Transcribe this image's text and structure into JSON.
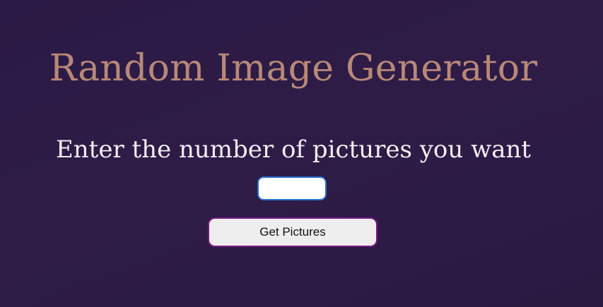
{
  "page": {
    "title": "Random Image Generator",
    "prompt": "Enter the number of pictures you want"
  },
  "form": {
    "count_value": "",
    "count_placeholder": "",
    "submit_label": "Get Pictures"
  },
  "colors": {
    "background": "#2d1b46",
    "title": "#b88878",
    "prompt": "#f4eef6",
    "input_border": "#2a6fd0",
    "button_border": "#7a1a86",
    "button_background": "#efeeef"
  }
}
